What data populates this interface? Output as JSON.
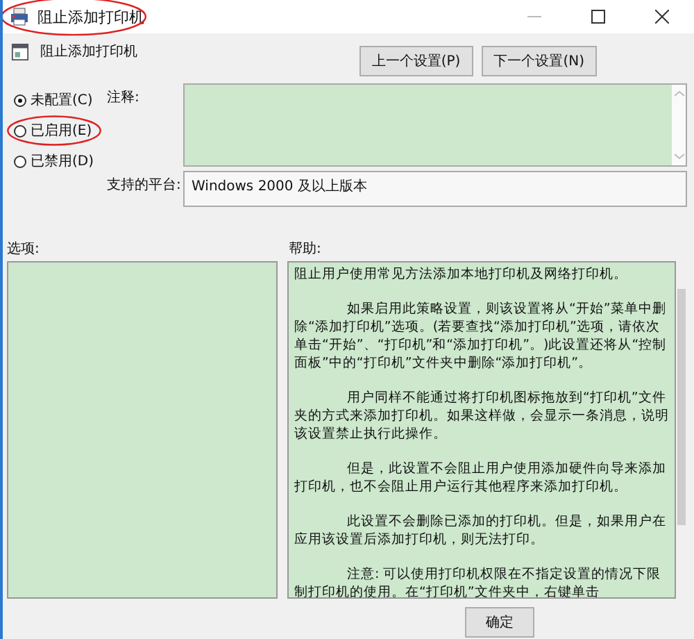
{
  "window": {
    "title": "阻止添加打印机",
    "highlighted": true
  },
  "header": {
    "title": "阻止添加打印机"
  },
  "nav_buttons": [
    "上一个设置(P)",
    "下一个设置(N)"
  ],
  "radio_options": [
    {
      "label": "未配置(C)",
      "selected": true,
      "highlighted": false
    },
    {
      "label": "已启用(E)",
      "selected": false,
      "highlighted": true
    },
    {
      "label": "已禁用(D)",
      "selected": false,
      "highlighted": false
    }
  ],
  "comment": {
    "label": "注释:"
  },
  "platform": {
    "label": "支持的平台:",
    "value": "Windows 2000 及以上版本"
  },
  "options": {
    "label": "选项:"
  },
  "help": {
    "label": "帮助:",
    "paragraphs": [
      "阻止用户使用常见方法添加本地打印机及网络打印机。",
      "如果启用此策略设置，则该设置将从“开始”菜单中删除“添加打印机”选项。(若要查找“添加打印机”选项，请依次单击“开始”、“打印机”和“添加打印机”。)此设置还将从“控制面板”中的“打印机”文件夹中删除“添加打印机”。",
      "用户同样不能通过将打印机图标拖放到“打印机”文件夹的方式来添加打印机。如果这样做，会显示一条消息，说明该设置禁止执行此操作。",
      "但是，此设置不会阻止用户使用添加硬件向导来添加打印机，也不会阻止用户运行其他程序来添加打印机。",
      "此设置不会删除已添加的打印机。但是，如果用户在应用该设置后添加打印机，则无法打印。",
      "注意: 可以使用打印机权限在不指定设置的情况下限制打印机的使用。在“打印机”文件夹中，右键单击"
    ]
  },
  "footer_buttons": [
    "确定"
  ]
}
